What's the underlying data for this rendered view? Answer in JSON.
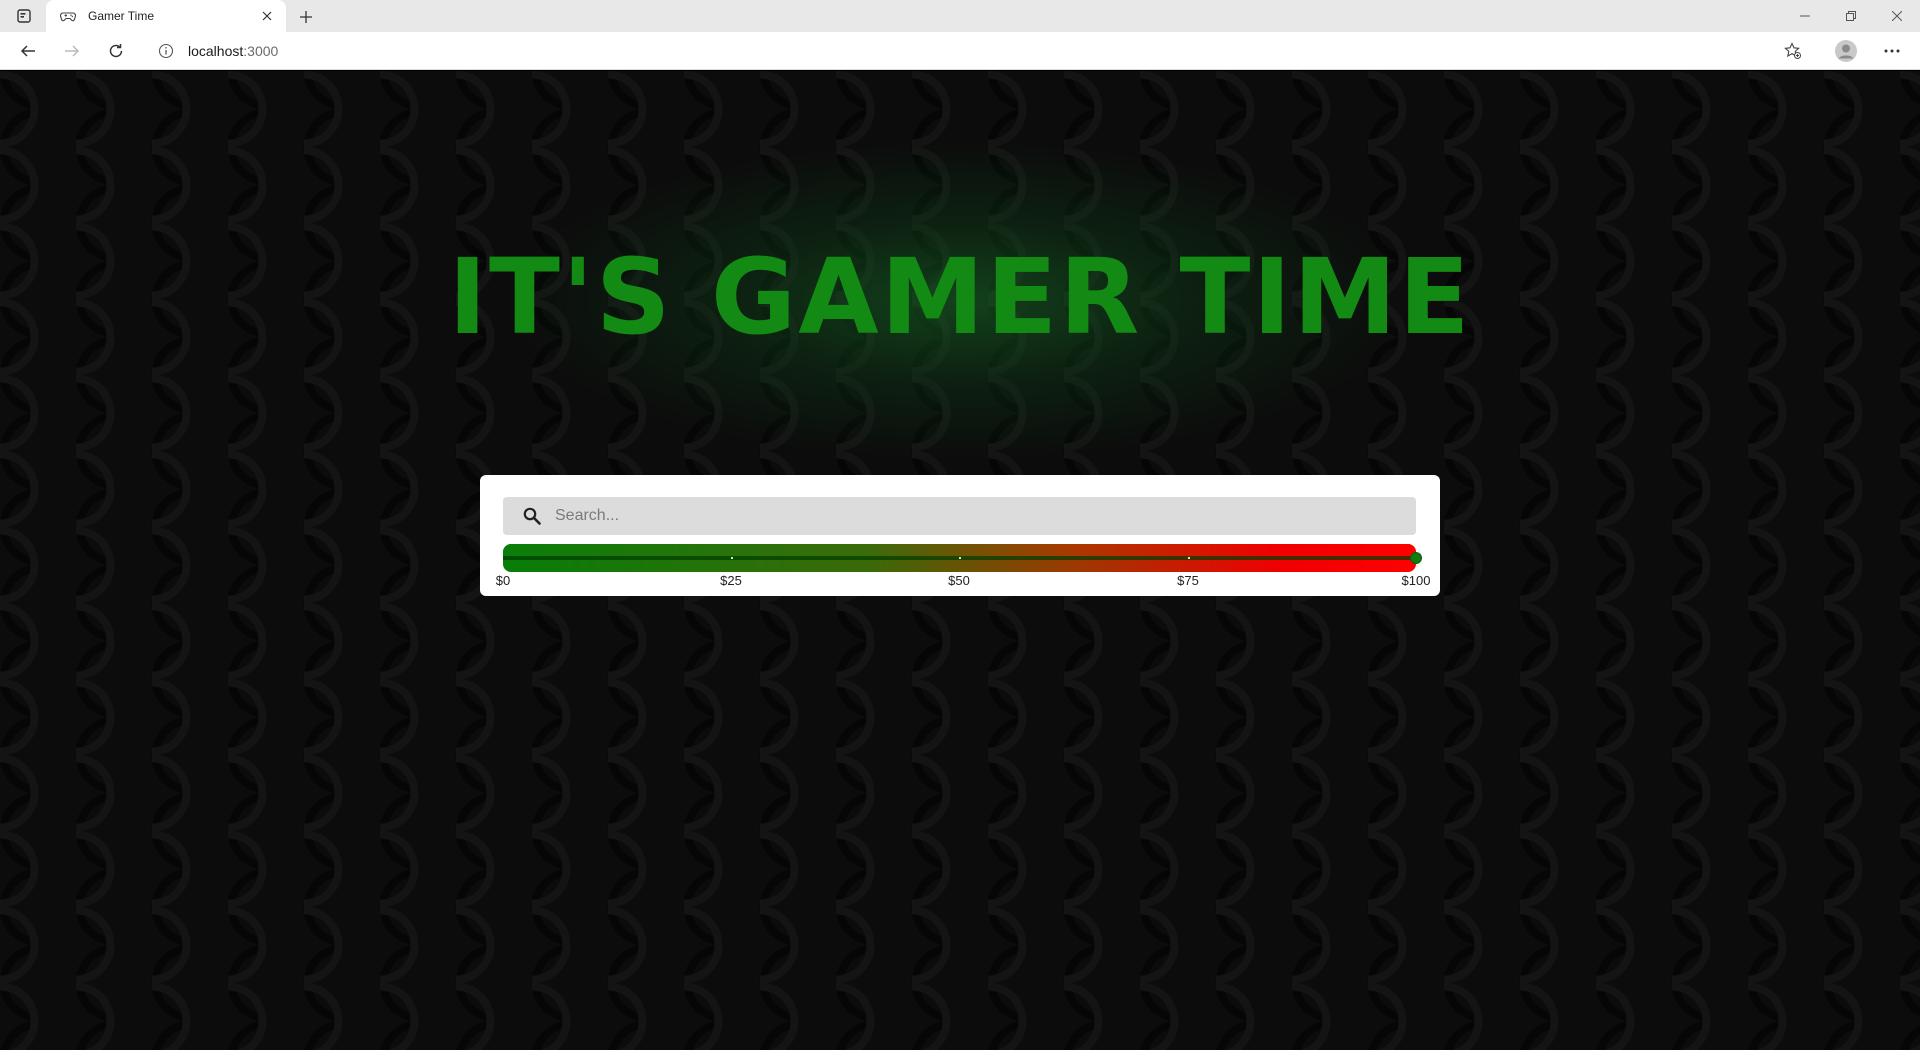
{
  "browser": {
    "tab_title": "Gamer Time",
    "url_host": "localhost",
    "url_port": ":3000"
  },
  "page": {
    "headline": "IT'S GAMER TIME",
    "search": {
      "placeholder": "Search..."
    },
    "price_slider": {
      "min": 0,
      "max": 100,
      "value": 100,
      "tick_labels": [
        "$0",
        "$25",
        "$50",
        "$75",
        "$100"
      ],
      "colors": {
        "low": "#087d08",
        "high": "#ff0000",
        "thumb": "#0f7d0f"
      }
    },
    "colors": {
      "headline": "#138a13",
      "background": "#0a0a0a",
      "panel": "#ffffff"
    }
  },
  "icons": {
    "tab_actions": "tab-actions-icon",
    "favicon": "gamepad-icon",
    "close": "close-icon",
    "new_tab": "plus-icon",
    "back": "back-arrow-icon",
    "forward": "forward-arrow-icon",
    "refresh": "refresh-icon",
    "info": "info-icon",
    "favorites": "favorites-icon",
    "profile": "profile-icon",
    "more": "more-icon",
    "search": "search-icon"
  }
}
